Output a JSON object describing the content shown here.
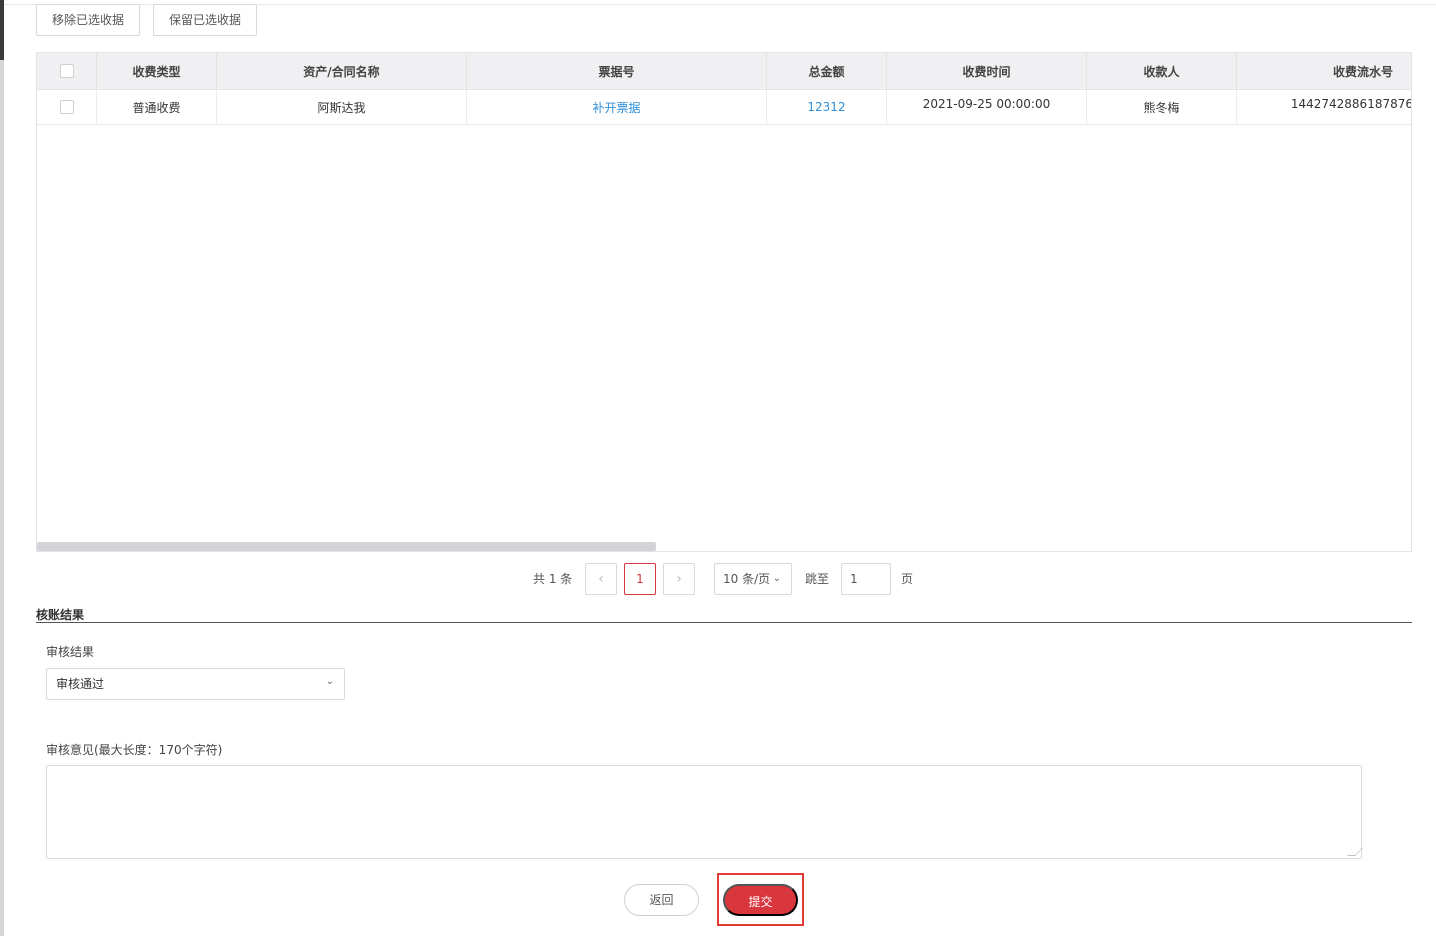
{
  "toolbar": {
    "remove_selected_label": "移除已选收据",
    "keep_selected_label": "保留已选收据"
  },
  "table": {
    "columns": [
      "",
      "收费类型",
      "资产/合同名称",
      "票据号",
      "总金额",
      "收费时间",
      "收款人",
      "收费流水号"
    ],
    "rows": [
      {
        "fee_type": "普通收费",
        "asset_contract": "阿斯达我",
        "receipt_no": "补开票据",
        "total_amount": "12312",
        "fee_time": "2021-09-25 00:00:00",
        "payee": "熊冬梅",
        "serial_no": "1442742886187876"
      }
    ]
  },
  "pagination": {
    "total_text": "共 1 条",
    "prev_icon": "‹",
    "current_page": "1",
    "next_icon": "›",
    "page_size": "10 条/页",
    "goto_label": "跳至",
    "goto_value": "1",
    "page_suffix": "页"
  },
  "audit": {
    "section_title": "核账结果",
    "result_label": "审核结果",
    "result_value": "审核通过",
    "opinion_label": "审核意见(最大长度：170个字符)",
    "opinion_value": ""
  },
  "actions": {
    "back_label": "返回",
    "submit_label": "提交"
  },
  "colors": {
    "accent": "#d9363e",
    "link": "#2f8fd8",
    "highlight_box": "#e53935"
  }
}
